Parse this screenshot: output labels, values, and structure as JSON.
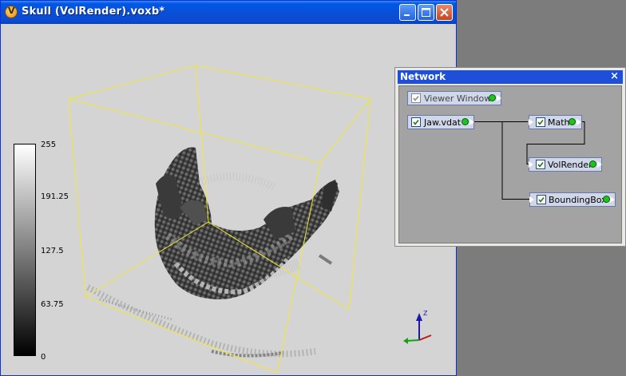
{
  "window": {
    "title": "Skull (VolRender).voxb*"
  },
  "colorbar": {
    "labels": [
      "255",
      "191.25",
      "127.5",
      "63.75",
      "0"
    ]
  },
  "axes": {
    "z_label": "Z"
  },
  "network": {
    "title": "Network",
    "close_glyph": "×",
    "nodes": [
      {
        "label": "Viewer Window",
        "checked": true,
        "enabled": false
      },
      {
        "label": "Jaw.vdat",
        "checked": true
      },
      {
        "label": "Math",
        "checked": true
      },
      {
        "label": "VolRender",
        "checked": true
      },
      {
        "label": "BoundingBox",
        "checked": true
      }
    ]
  },
  "colors": {
    "bbox": "#f0e836",
    "title_blue": "#0a4bd0",
    "port_green": "#1ec41e"
  }
}
